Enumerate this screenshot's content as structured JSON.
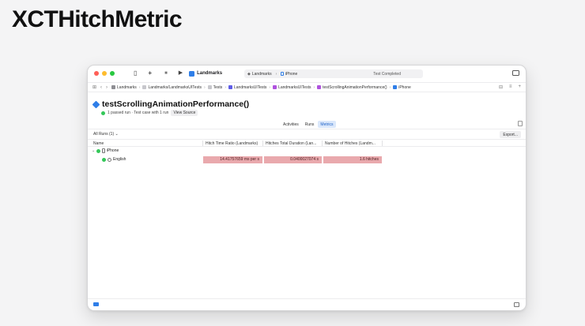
{
  "headline": "XCTHitchMetric",
  "toolbar": {
    "app_name": "Landmarks",
    "scheme_target": "Landmarks",
    "scheme_device": "iPhone",
    "status": "Test Completed"
  },
  "breadcrumbs": [
    "Landmarks",
    "Landmarks/LandmarksUITests",
    "Tests",
    "LandmarksUITests",
    "LandmarksUITests",
    "testScrollingAnimationPerformance()",
    "iPhone"
  ],
  "test": {
    "title": "testScrollingAnimationPerformance()",
    "summary": "1 passed run · Test case with 1 run",
    "view_source": "View Source"
  },
  "tabs": [
    {
      "label": "Activities",
      "active": false
    },
    {
      "label": "Runs",
      "active": false
    },
    {
      "label": "Metrics",
      "active": true
    }
  ],
  "filter_label": "All Runs (1) ⌄",
  "export_label": "Export...",
  "columns": {
    "name": "Name",
    "hitch_ratio": "Hitch Time Ratio (Landmarks)",
    "hitch_duration": "Hitches Total Duration (Lan...",
    "hitch_count": "Number of Hitches (Landm..."
  },
  "rows": {
    "device": "iPhone",
    "locale": "English",
    "hitch_ratio": "14.41757659 ms per s",
    "hitch_duration": "0.0400027074 s",
    "hitch_count": "1.6 hitches"
  },
  "colors": {
    "accent": "#2f7ee8",
    "pass": "#34c759",
    "metric_bad": "#e9a9ad"
  }
}
